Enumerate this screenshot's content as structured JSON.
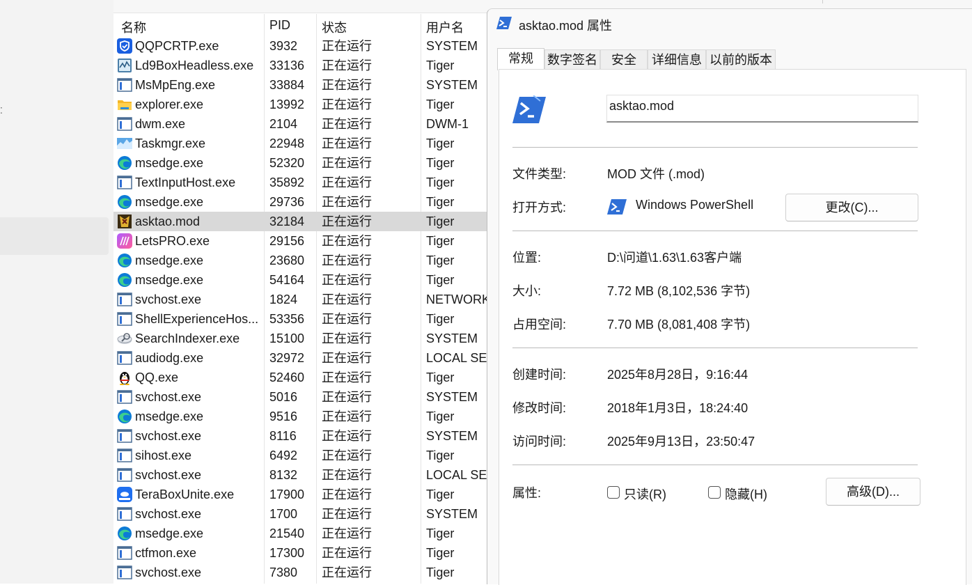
{
  "processes": {
    "headers": {
      "name": "名称",
      "pid": "PID",
      "status": "状态",
      "user": "用户名"
    },
    "rows": [
      {
        "name": "QQPCRTP.exe",
        "pid": "3932",
        "status": "正在运行",
        "user": "SYSTEM",
        "icon": "shield-icon"
      },
      {
        "name": "Ld9BoxHeadless.exe",
        "pid": "33136",
        "status": "正在运行",
        "user": "Tiger",
        "icon": "monitor-chart-icon"
      },
      {
        "name": "MsMpEng.exe",
        "pid": "33884",
        "status": "正在运行",
        "user": "SYSTEM",
        "icon": "window-app-icon"
      },
      {
        "name": "explorer.exe",
        "pid": "13992",
        "status": "正在运行",
        "user": "Tiger",
        "icon": "folder-icon"
      },
      {
        "name": "dwm.exe",
        "pid": "2104",
        "status": "正在运行",
        "user": "DWM-1",
        "icon": "window-app-icon"
      },
      {
        "name": "Taskmgr.exe",
        "pid": "22948",
        "status": "正在运行",
        "user": "Tiger",
        "icon": "taskmgr-icon"
      },
      {
        "name": "msedge.exe",
        "pid": "52320",
        "status": "正在运行",
        "user": "Tiger",
        "icon": "edge-icon"
      },
      {
        "name": "TextInputHost.exe",
        "pid": "35892",
        "status": "正在运行",
        "user": "Tiger",
        "icon": "window-app-icon"
      },
      {
        "name": "msedge.exe",
        "pid": "29736",
        "status": "正在运行",
        "user": "Tiger",
        "icon": "edge-icon"
      },
      {
        "name": "asktao.mod",
        "pid": "32184",
        "status": "正在运行",
        "user": "Tiger",
        "icon": "game-icon",
        "selected": true
      },
      {
        "name": "LetsPRO.exe",
        "pid": "29156",
        "status": "正在运行",
        "user": "Tiger",
        "icon": "letspro-icon"
      },
      {
        "name": "msedge.exe",
        "pid": "23680",
        "status": "正在运行",
        "user": "Tiger",
        "icon": "edge-icon"
      },
      {
        "name": "msedge.exe",
        "pid": "54164",
        "status": "正在运行",
        "user": "Tiger",
        "icon": "edge-icon"
      },
      {
        "name": "svchost.exe",
        "pid": "1824",
        "status": "正在运行",
        "user": "NETWORK",
        "icon": "window-app-icon"
      },
      {
        "name": "ShellExperienceHos...",
        "pid": "53356",
        "status": "正在运行",
        "user": "Tiger",
        "icon": "window-app-icon"
      },
      {
        "name": "SearchIndexer.exe",
        "pid": "15100",
        "status": "正在运行",
        "user": "SYSTEM",
        "icon": "search-indexer-icon"
      },
      {
        "name": "audiodg.exe",
        "pid": "32972",
        "status": "正在运行",
        "user": "LOCAL SE...",
        "icon": "window-app-icon"
      },
      {
        "name": "QQ.exe",
        "pid": "52460",
        "status": "正在运行",
        "user": "Tiger",
        "icon": "penguin-icon"
      },
      {
        "name": "svchost.exe",
        "pid": "5016",
        "status": "正在运行",
        "user": "SYSTEM",
        "icon": "window-app-icon"
      },
      {
        "name": "msedge.exe",
        "pid": "9516",
        "status": "正在运行",
        "user": "Tiger",
        "icon": "edge-icon"
      },
      {
        "name": "svchost.exe",
        "pid": "8116",
        "status": "正在运行",
        "user": "SYSTEM",
        "icon": "window-app-icon"
      },
      {
        "name": "sihost.exe",
        "pid": "6492",
        "status": "正在运行",
        "user": "Tiger",
        "icon": "window-app-icon"
      },
      {
        "name": "svchost.exe",
        "pid": "8132",
        "status": "正在运行",
        "user": "LOCAL SE...",
        "icon": "window-app-icon"
      },
      {
        "name": "TeraBoxUnite.exe",
        "pid": "17900",
        "status": "正在运行",
        "user": "Tiger",
        "icon": "terabox-icon"
      },
      {
        "name": "svchost.exe",
        "pid": "1700",
        "status": "正在运行",
        "user": "SYSTEM",
        "icon": "window-app-icon"
      },
      {
        "name": "msedge.exe",
        "pid": "21540",
        "status": "正在运行",
        "user": "Tiger",
        "icon": "edge-icon"
      },
      {
        "name": "ctfmon.exe",
        "pid": "17300",
        "status": "正在运行",
        "user": "Tiger",
        "icon": "window-app-icon"
      },
      {
        "name": "svchost.exe",
        "pid": "7380",
        "status": "正在运行",
        "user": "Tiger",
        "icon": "window-app-icon"
      }
    ]
  },
  "dialog": {
    "title": "asktao.mod 属性",
    "tabs": [
      "常规",
      "数字签名",
      "安全",
      "详细信息",
      "以前的版本"
    ],
    "active_tab": "常规",
    "file_name": "asktao.mod",
    "file_type_label": "文件类型:",
    "file_type": "MOD 文件 (.mod)",
    "open_with_label": "打开方式:",
    "open_with": "Windows PowerShell",
    "change_button": "更改(C)...",
    "location_label": "位置:",
    "location": "D:\\问道\\1.63\\1.63客户端",
    "size_label": "大小:",
    "size": "7.72 MB (8,102,536 字节)",
    "disk_size_label": "占用空间:",
    "disk_size": "7.70 MB (8,081,408 字节)",
    "created_label": "创建时间:",
    "created": "2025年8月28日，9:16:44",
    "modified_label": "修改时间:",
    "modified": "2018年1月3日，18:24:40",
    "accessed_label": "访问时间:",
    "accessed": "2025年9月13日，23:50:47",
    "attributes_label": "属性:",
    "readonly_label": "只读(R)",
    "readonly_checked": false,
    "hidden_label": "隐藏(H)",
    "hidden_checked": false,
    "advanced_button": "高级(D)..."
  },
  "colors": {
    "selected_row": "#d9d9d9",
    "powershell_blue": "#2f6fd6",
    "edge_blue": "#0c7bd6"
  }
}
